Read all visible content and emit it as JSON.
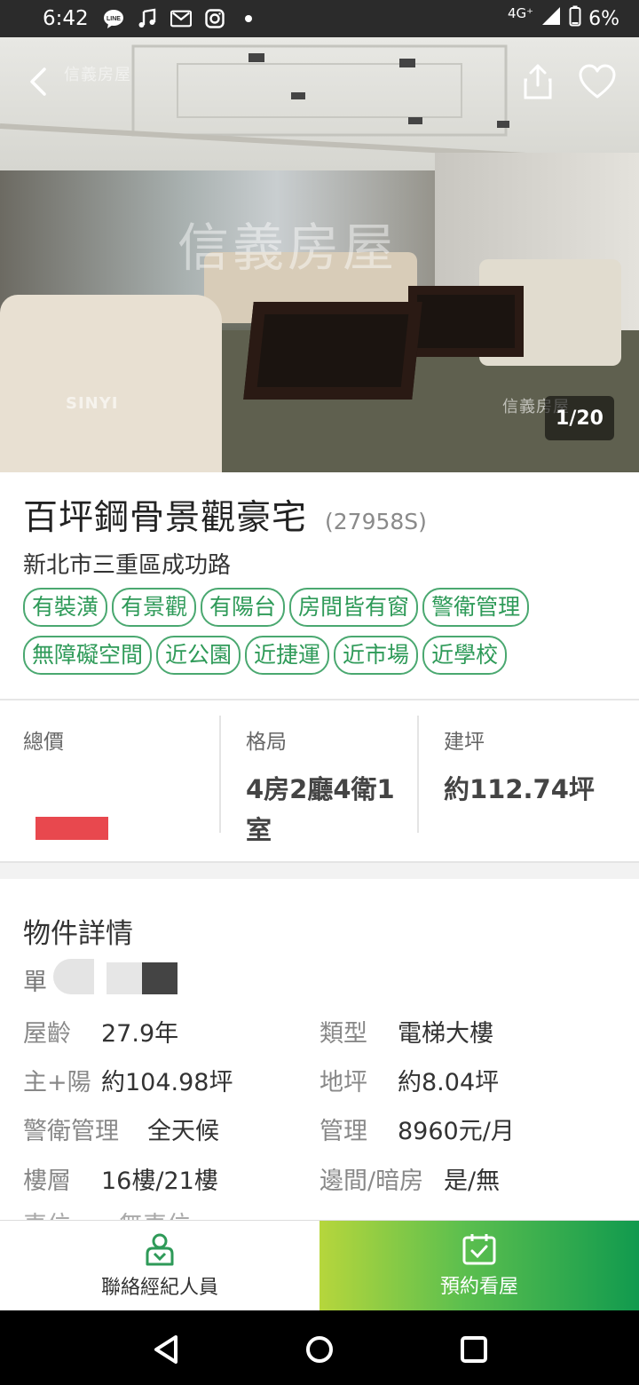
{
  "status_bar": {
    "time": "6:42",
    "network": "4G⁺",
    "battery": "6%"
  },
  "hero": {
    "watermark_top": "信義房屋",
    "watermark_center": "信義房屋",
    "watermark_bottom_left": "SINYI",
    "watermark_bottom_right": "信義房屋",
    "counter": "1/20"
  },
  "listing": {
    "title": "百坪鋼骨景觀豪宅",
    "code": "(27958S)",
    "address": "新北市三重區成功路",
    "tags": [
      "有裝潢",
      "有景觀",
      "有陽台",
      "房間皆有窗",
      "警衛管理",
      "無障礙空間",
      "近公園",
      "近捷運",
      "近市場",
      "近學校"
    ]
  },
  "stats": {
    "total_price_label": "總價",
    "layout_label": "格局",
    "layout_value": "4房2廳4衛1室",
    "area_label": "建坪",
    "area_value": "約112.74坪"
  },
  "details": {
    "title": "物件詳情",
    "unit_label": "單",
    "rows": [
      {
        "l1": "屋齡",
        "v1": "27.9年",
        "l2": "類型",
        "v2": "電梯大樓"
      },
      {
        "l1": "主+陽",
        "v1": "約104.98坪",
        "l2": "地坪",
        "v2": "約8.04坪"
      },
      {
        "l1": "警衛管理",
        "v1": "全天候",
        "l2": "管理",
        "v2": "8960元/月"
      },
      {
        "l1": "樓層",
        "v1": "16樓/21樓",
        "l2": "邊間/暗房",
        "v2": "是/無"
      }
    ],
    "cut_row": "車位　　無車位"
  },
  "actions": {
    "contact_label": "聯絡經紀人員",
    "book_label": "預約看屋"
  },
  "colors": {
    "accent_green": "#2e9a58",
    "tag_border": "#4aa870"
  }
}
